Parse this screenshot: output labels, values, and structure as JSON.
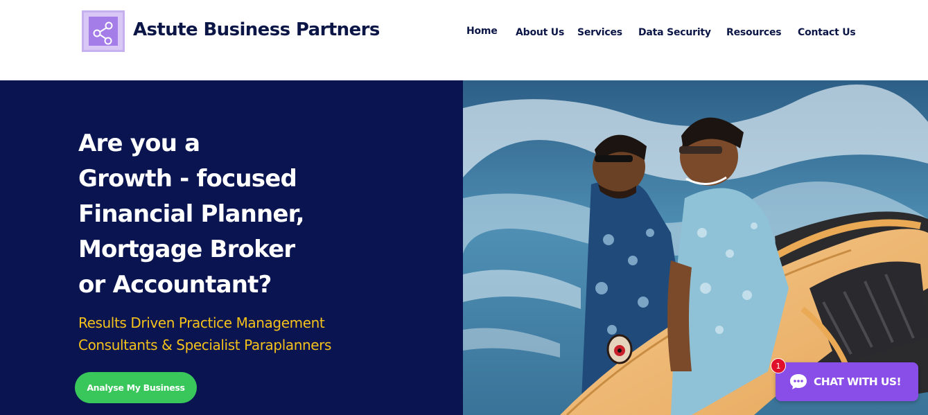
{
  "brand": {
    "name": "Astute Business Partners",
    "logo_icon": "share-nodes-icon"
  },
  "nav": {
    "items": [
      {
        "label": "Home"
      },
      {
        "label": "About Us"
      },
      {
        "label": "Services"
      },
      {
        "label": "Data Security"
      },
      {
        "label": "Resources"
      },
      {
        "label": "Contact Us"
      }
    ]
  },
  "hero": {
    "title_lines": [
      "Are you a",
      "Growth - focused",
      "Financial Planner,",
      "Mortgage Broker",
      "or Accountant?"
    ],
    "subtitle_lines": [
      "Results Driven Practice Management",
      "Consultants & Specialist Paraplanners"
    ],
    "cta_label": "Analyse My Business",
    "image_icon": "surfers-photo"
  },
  "chat": {
    "label": "CHAT WITH US!",
    "badge_count": "1",
    "icon": "chat-bubble-icon"
  },
  "colors": {
    "navy": "#0a1451",
    "accent_yellow": "#f4c21a",
    "cta_green": "#39c65a",
    "chat_purple": "#8a4ee8",
    "badge_red": "#e0102a"
  }
}
